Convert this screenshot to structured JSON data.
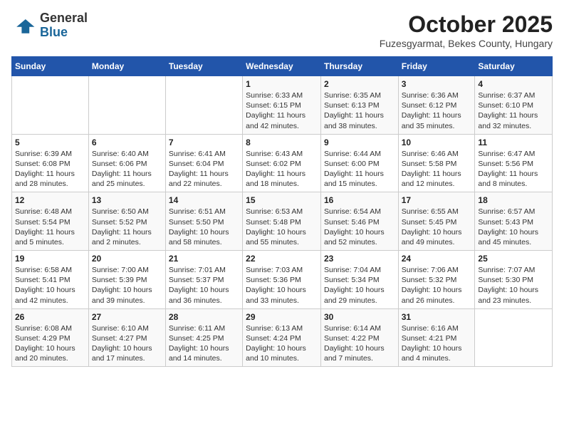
{
  "logo": {
    "general": "General",
    "blue": "Blue"
  },
  "header": {
    "month": "October 2025",
    "location": "Fuzesgyarmat, Bekes County, Hungary"
  },
  "weekdays": [
    "Sunday",
    "Monday",
    "Tuesday",
    "Wednesday",
    "Thursday",
    "Friday",
    "Saturday"
  ],
  "weeks": [
    [
      {
        "day": "",
        "content": ""
      },
      {
        "day": "",
        "content": ""
      },
      {
        "day": "",
        "content": ""
      },
      {
        "day": "1",
        "content": "Sunrise: 6:33 AM\nSunset: 6:15 PM\nDaylight: 11 hours\nand 42 minutes."
      },
      {
        "day": "2",
        "content": "Sunrise: 6:35 AM\nSunset: 6:13 PM\nDaylight: 11 hours\nand 38 minutes."
      },
      {
        "day": "3",
        "content": "Sunrise: 6:36 AM\nSunset: 6:12 PM\nDaylight: 11 hours\nand 35 minutes."
      },
      {
        "day": "4",
        "content": "Sunrise: 6:37 AM\nSunset: 6:10 PM\nDaylight: 11 hours\nand 32 minutes."
      }
    ],
    [
      {
        "day": "5",
        "content": "Sunrise: 6:39 AM\nSunset: 6:08 PM\nDaylight: 11 hours\nand 28 minutes."
      },
      {
        "day": "6",
        "content": "Sunrise: 6:40 AM\nSunset: 6:06 PM\nDaylight: 11 hours\nand 25 minutes."
      },
      {
        "day": "7",
        "content": "Sunrise: 6:41 AM\nSunset: 6:04 PM\nDaylight: 11 hours\nand 22 minutes."
      },
      {
        "day": "8",
        "content": "Sunrise: 6:43 AM\nSunset: 6:02 PM\nDaylight: 11 hours\nand 18 minutes."
      },
      {
        "day": "9",
        "content": "Sunrise: 6:44 AM\nSunset: 6:00 PM\nDaylight: 11 hours\nand 15 minutes."
      },
      {
        "day": "10",
        "content": "Sunrise: 6:46 AM\nSunset: 5:58 PM\nDaylight: 11 hours\nand 12 minutes."
      },
      {
        "day": "11",
        "content": "Sunrise: 6:47 AM\nSunset: 5:56 PM\nDaylight: 11 hours\nand 8 minutes."
      }
    ],
    [
      {
        "day": "12",
        "content": "Sunrise: 6:48 AM\nSunset: 5:54 PM\nDaylight: 11 hours\nand 5 minutes."
      },
      {
        "day": "13",
        "content": "Sunrise: 6:50 AM\nSunset: 5:52 PM\nDaylight: 11 hours\nand 2 minutes."
      },
      {
        "day": "14",
        "content": "Sunrise: 6:51 AM\nSunset: 5:50 PM\nDaylight: 10 hours\nand 58 minutes."
      },
      {
        "day": "15",
        "content": "Sunrise: 6:53 AM\nSunset: 5:48 PM\nDaylight: 10 hours\nand 55 minutes."
      },
      {
        "day": "16",
        "content": "Sunrise: 6:54 AM\nSunset: 5:46 PM\nDaylight: 10 hours\nand 52 minutes."
      },
      {
        "day": "17",
        "content": "Sunrise: 6:55 AM\nSunset: 5:45 PM\nDaylight: 10 hours\nand 49 minutes."
      },
      {
        "day": "18",
        "content": "Sunrise: 6:57 AM\nSunset: 5:43 PM\nDaylight: 10 hours\nand 45 minutes."
      }
    ],
    [
      {
        "day": "19",
        "content": "Sunrise: 6:58 AM\nSunset: 5:41 PM\nDaylight: 10 hours\nand 42 minutes."
      },
      {
        "day": "20",
        "content": "Sunrise: 7:00 AM\nSunset: 5:39 PM\nDaylight: 10 hours\nand 39 minutes."
      },
      {
        "day": "21",
        "content": "Sunrise: 7:01 AM\nSunset: 5:37 PM\nDaylight: 10 hours\nand 36 minutes."
      },
      {
        "day": "22",
        "content": "Sunrise: 7:03 AM\nSunset: 5:36 PM\nDaylight: 10 hours\nand 33 minutes."
      },
      {
        "day": "23",
        "content": "Sunrise: 7:04 AM\nSunset: 5:34 PM\nDaylight: 10 hours\nand 29 minutes."
      },
      {
        "day": "24",
        "content": "Sunrise: 7:06 AM\nSunset: 5:32 PM\nDaylight: 10 hours\nand 26 minutes."
      },
      {
        "day": "25",
        "content": "Sunrise: 7:07 AM\nSunset: 5:30 PM\nDaylight: 10 hours\nand 23 minutes."
      }
    ],
    [
      {
        "day": "26",
        "content": "Sunrise: 6:08 AM\nSunset: 4:29 PM\nDaylight: 10 hours\nand 20 minutes."
      },
      {
        "day": "27",
        "content": "Sunrise: 6:10 AM\nSunset: 4:27 PM\nDaylight: 10 hours\nand 17 minutes."
      },
      {
        "day": "28",
        "content": "Sunrise: 6:11 AM\nSunset: 4:25 PM\nDaylight: 10 hours\nand 14 minutes."
      },
      {
        "day": "29",
        "content": "Sunrise: 6:13 AM\nSunset: 4:24 PM\nDaylight: 10 hours\nand 10 minutes."
      },
      {
        "day": "30",
        "content": "Sunrise: 6:14 AM\nSunset: 4:22 PM\nDaylight: 10 hours\nand 7 minutes."
      },
      {
        "day": "31",
        "content": "Sunrise: 6:16 AM\nSunset: 4:21 PM\nDaylight: 10 hours\nand 4 minutes."
      },
      {
        "day": "",
        "content": ""
      }
    ]
  ]
}
